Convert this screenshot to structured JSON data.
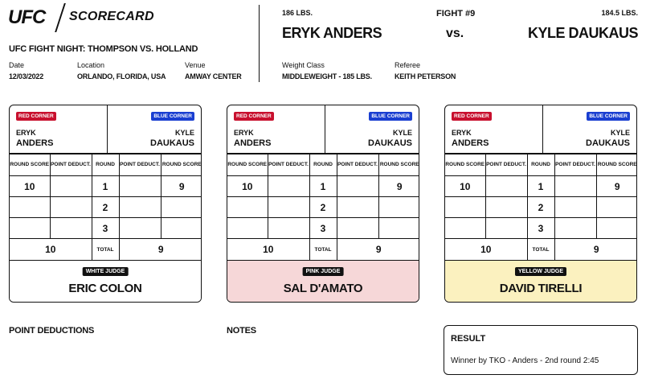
{
  "header": {
    "brand": "UFC",
    "title": "SCORECARD",
    "event": "UFC FIGHT NIGHT: THOMPSON VS. HOLLAND",
    "date_label": "Date",
    "date": "12/03/2022",
    "location_label": "Location",
    "location": "ORLANDO, FLORIDA, USA",
    "venue_label": "Venue",
    "venue": "AMWAY CENTER"
  },
  "fight": {
    "number": "FIGHT #9",
    "vs": "vs.",
    "red_weight": "186 LBS.",
    "red_name": "ERYK ANDERS",
    "blue_weight": "184.5 LBS.",
    "blue_name": "KYLE DAUKAUS",
    "weight_class_label": "Weight Class",
    "weight_class": "MIDDLEWEIGHT - 185 LBS.",
    "referee_label": "Referee",
    "referee": "KEITH PETERSON"
  },
  "columns": {
    "round_score": "ROUND SCORE",
    "point_deduct": "POINT DEDUCT.",
    "round": "ROUND",
    "total": "TOTAL"
  },
  "corners": {
    "red_label": "RED CORNER",
    "blue_label": "BLUE CORNER",
    "red_first": "ERYK",
    "red_last": "ANDERS",
    "blue_first": "KYLE",
    "blue_last": "DAUKAUS"
  },
  "rounds": [
    "1",
    "2",
    "3"
  ],
  "judges": [
    {
      "badge": "WHITE JUDGE",
      "name": "ERIC COLON",
      "color": "#ffffff",
      "red_scores": [
        "10",
        "",
        ""
      ],
      "red_deducts": [
        "",
        "",
        ""
      ],
      "blue_deducts": [
        "",
        "",
        ""
      ],
      "blue_scores": [
        "9",
        "",
        ""
      ],
      "red_total": "10",
      "blue_total": "9"
    },
    {
      "badge": "PINK JUDGE",
      "name": "SAL D'AMATO",
      "color": "#f6d7d8",
      "red_scores": [
        "10",
        "",
        ""
      ],
      "red_deducts": [
        "",
        "",
        ""
      ],
      "blue_deducts": [
        "",
        "",
        ""
      ],
      "blue_scores": [
        "9",
        "",
        ""
      ],
      "red_total": "10",
      "blue_total": "9"
    },
    {
      "badge": "YELLOW JUDGE",
      "name": "DAVID TIRELLI",
      "color": "#fbf1bf",
      "red_scores": [
        "10",
        "",
        ""
      ],
      "red_deducts": [
        "",
        "",
        ""
      ],
      "blue_deducts": [
        "",
        "",
        ""
      ],
      "blue_scores": [
        "9",
        "",
        ""
      ],
      "red_total": "10",
      "blue_total": "9"
    }
  ],
  "footer": {
    "point_deductions_label": "POINT DEDUCTIONS",
    "notes_label": "NOTES",
    "result_label": "RESULT",
    "result_text": "Winner by TKO - Anders - 2nd round 2:45"
  },
  "colors": {
    "red_corner": "#c8102e",
    "blue_corner": "#1a3fd1"
  }
}
